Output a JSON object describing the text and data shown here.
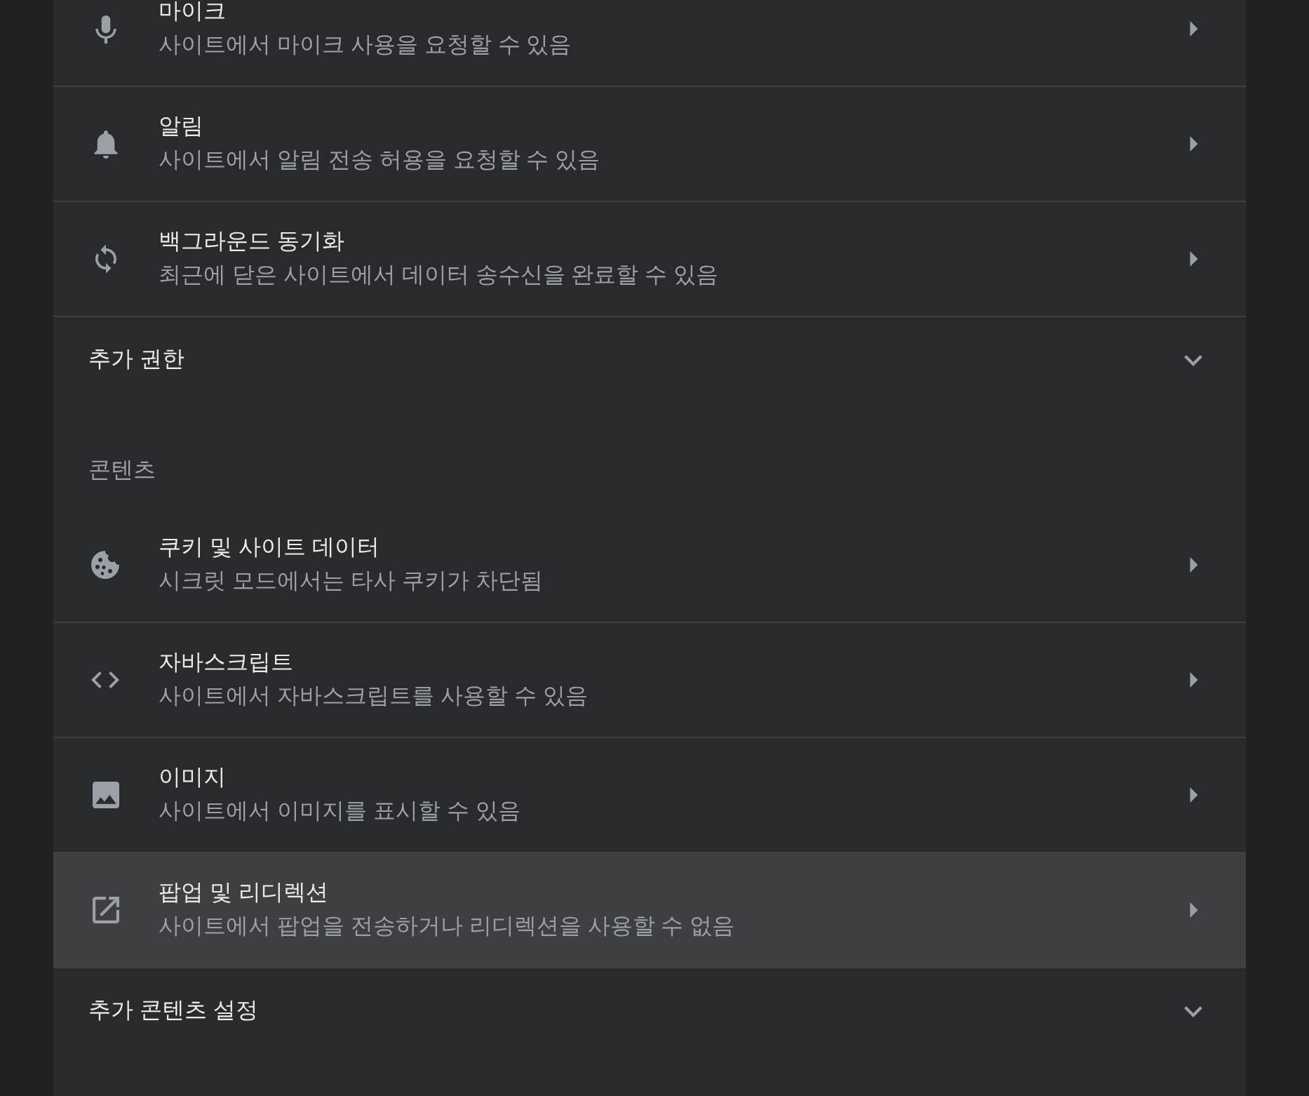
{
  "site_permissions": [
    {
      "title": "마이크",
      "description": "사이트에서 마이크 사용을 요청할 수 있음",
      "hovered": false
    },
    {
      "title": "알림",
      "description": "사이트에서 알림 전송 허용을 요청할 수 있음",
      "hovered": false
    },
    {
      "title": "백그라운드 동기화",
      "description": "최근에 닫은 사이트에서 데이터 송수신을 완료할 수 있음",
      "hovered": false
    }
  ],
  "additional_permissions": {
    "label": "추가 권한",
    "expanded": false
  },
  "content": {
    "heading": "콘텐츠",
    "items": [
      {
        "title": "쿠키 및 사이트 데이터",
        "description": "시크릿 모드에서는 타사 쿠키가 차단됨",
        "hovered": false
      },
      {
        "title": "자바스크립트",
        "description": "사이트에서 자바스크립트를 사용할 수 있음",
        "hovered": false
      },
      {
        "title": "이미지",
        "description": "사이트에서 이미지를 표시할 수 있음",
        "hovered": false
      },
      {
        "title": "팝업 및 리디렉션",
        "description": "사이트에서 팝업을 전송하거나 리디렉션을 사용할 수 없음",
        "hovered": true
      }
    ]
  },
  "additional_content_settings": {
    "label": "추가 콘텐츠 설정",
    "expanded": false
  }
}
